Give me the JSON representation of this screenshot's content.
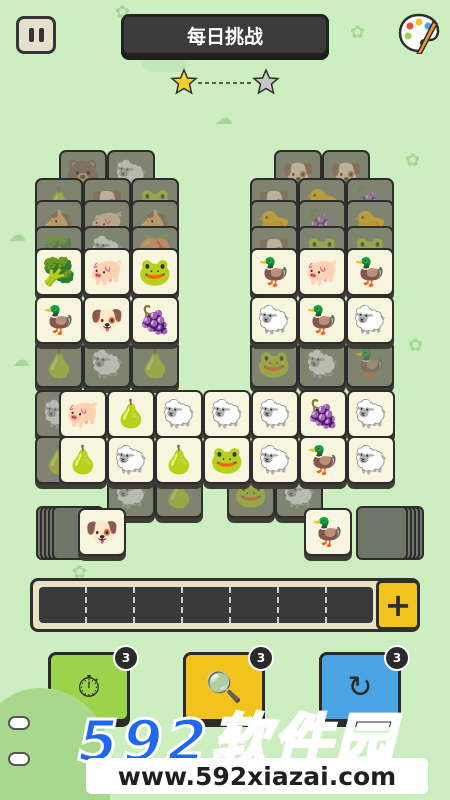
{
  "header": {
    "title": "每日挑战"
  },
  "icons": {
    "pause": "pause-icon",
    "palette": "palette-icon",
    "star": "star-icon"
  },
  "board": {
    "top_left_dim": [
      "🐻",
      "🐑",
      "🍐",
      "🐶",
      "🐸",
      "🐴",
      "🐖",
      "🐴",
      "🥦",
      "🐑",
      "🍑"
    ],
    "top_right_dim": [
      "🐶",
      "🐶",
      "🐶",
      "🐤",
      "🍇",
      "🐤",
      "🍇",
      "🐤",
      "🐶",
      "🐸",
      "🐸"
    ],
    "row1": [
      "🥦",
      "🐖",
      "🐸",
      "🦆",
      "🐖",
      "🦆"
    ],
    "row2": [
      "🦆",
      "🐶",
      "🍇",
      "🐑",
      "🦆",
      "🐑"
    ],
    "row3": [
      "🐖",
      "🍐",
      "🐑",
      "🐑",
      "🐑",
      "🍇",
      "🐑"
    ],
    "row4": [
      "🍐",
      "🐑",
      "🍐",
      "🐸",
      "🐑",
      "🦆",
      "🐑"
    ],
    "stack_left_top": "🐶",
    "stack_right_top": "🦆"
  },
  "slots": {
    "count": 7,
    "add_label": "+"
  },
  "tools": [
    {
      "name": "undo",
      "icon": "⏱",
      "count": "3",
      "color": "#9bd44a"
    },
    {
      "name": "hint",
      "icon": "🔍",
      "count": "3",
      "color": "#f2c21d"
    },
    {
      "name": "shuffle",
      "icon": "↻",
      "count": "3",
      "color": "#4aa3e3"
    }
  ],
  "watermark": {
    "brand": "592软件园",
    "url": "www.592xiazai.com"
  }
}
